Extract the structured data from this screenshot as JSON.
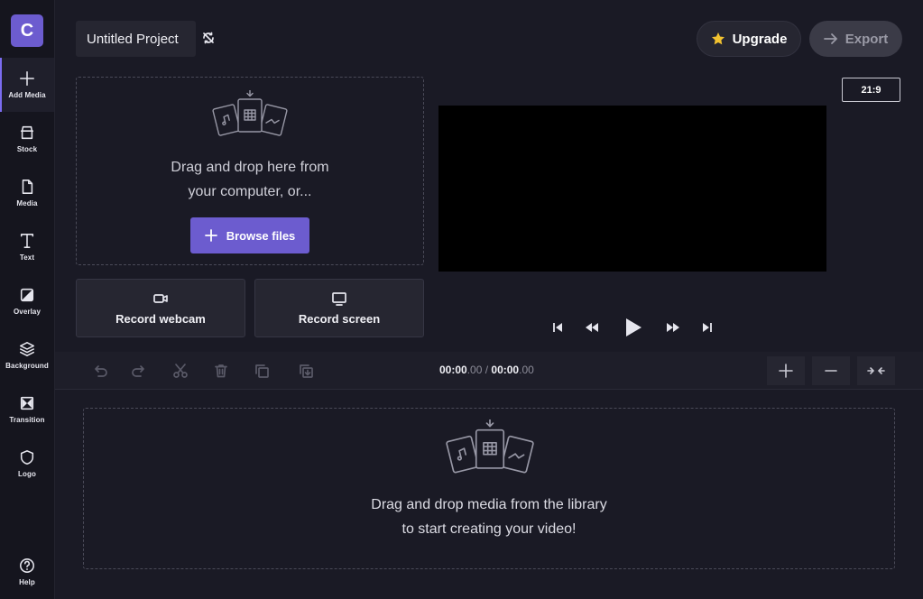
{
  "app": {
    "logo_letter": "C",
    "project_title": "Untitled Project"
  },
  "sidebar": {
    "items": [
      {
        "label": "Add Media"
      },
      {
        "label": "Stock"
      },
      {
        "label": "Media"
      },
      {
        "label": "Text"
      },
      {
        "label": "Overlay"
      },
      {
        "label": "Background"
      },
      {
        "label": "Transition"
      },
      {
        "label": "Logo"
      }
    ],
    "help_label": "Help"
  },
  "header": {
    "upgrade_label": "Upgrade",
    "export_label": "Export"
  },
  "upload": {
    "drop_text": "Drag and drop here from your computer, or...",
    "browse_label": "Browse files",
    "record_webcam_label": "Record webcam",
    "record_screen_label": "Record screen"
  },
  "preview": {
    "aspect_ratio": "21:9"
  },
  "timeline": {
    "current_time_main": "00:00",
    "current_time_ms": ".00",
    "separator": " / ",
    "total_time_main": "00:00",
    "total_time_ms": ".00",
    "drop_text": "Drag and drop media from the library to start creating your video!"
  },
  "colors": {
    "accent": "#6c5ccf",
    "background": "#1a1a25",
    "sidebar": "#15151e"
  }
}
